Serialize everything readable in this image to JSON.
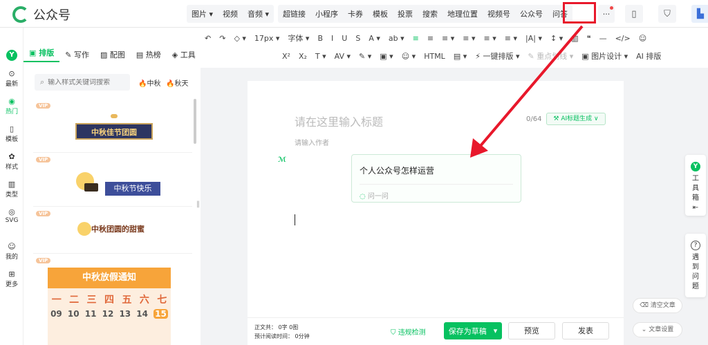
{
  "app": {
    "title": "公众号"
  },
  "topbar": {
    "menu_group_1": [
      "图片 ▾",
      "视频",
      "音频 ▾"
    ],
    "menu_group_2": [
      "超链接",
      "小程序",
      "卡券",
      "模板",
      "投票",
      "搜索",
      "地理位置",
      "视频号",
      "公众号",
      "问答"
    ],
    "more": "···",
    "highlighted": "问答"
  },
  "format_toolbar": {
    "row1": [
      "↶",
      "↷",
      "◇ ▾",
      "17px ▾",
      "字体 ▾",
      "B",
      "I",
      "U",
      "S",
      "A ▾",
      "ab ▾",
      "≡",
      "≡",
      "≡ ▾",
      "≡ ▾",
      "≡ ▾",
      "≡ ▾",
      "|A| ▾",
      "↕ ▾",
      "▥",
      "❝",
      "—",
      "</>",
      "☺"
    ],
    "row2": [
      "X²",
      "X₂",
      "T ▾",
      "AV ▾",
      "✎ ▾",
      "▣ ▾",
      "☺ ▾",
      "HTML",
      "▤ ▾",
      "⚡ 一键排版 ▾",
      "✎ 重点划线 ▾",
      "▣ 图片设计 ▾",
      "AI 排版"
    ]
  },
  "rail": {
    "items": [
      {
        "icon": "⊙",
        "label": "最新"
      },
      {
        "icon": "◉",
        "label": "热门"
      },
      {
        "icon": "▯",
        "label": "模板"
      },
      {
        "icon": "✿",
        "label": "样式"
      },
      {
        "icon": "▥",
        "label": "类型"
      },
      {
        "icon": "◎",
        "label": "SVG"
      },
      {
        "icon": "☺",
        "label": "我的"
      },
      {
        "icon": "⊞",
        "label": "更多"
      }
    ]
  },
  "panel": {
    "tabs": [
      "排版",
      "写作",
      "配图",
      "热榜",
      "工具"
    ],
    "search": {
      "placeholder": "输入样式关键词搜索"
    },
    "tags": [
      "中秋",
      "秋天"
    ],
    "vip_label": "VIP",
    "cards": {
      "c1": "中秋佳节团圆",
      "c2": "中秋节快乐",
      "c3": "中秋团圆的甜蜜",
      "c4": "中秋放假通知"
    },
    "calendar": {
      "weekdays": [
        "一",
        "二",
        "三",
        "四",
        "五",
        "六",
        "七"
      ],
      "days": [
        "09",
        "10",
        "11",
        "12",
        "13",
        "14",
        "15"
      ]
    }
  },
  "editor": {
    "title_placeholder": "请在这里输入标题",
    "title_count": "0/64",
    "ai_title_button": "AI标题生成 ∨",
    "author_placeholder": "请输入作者",
    "qa_card": {
      "title": "个人公众号怎样运营",
      "ask_label": "问一问"
    },
    "footer": {
      "word_count": "正文共： 0字 0图",
      "read_time": "预计阅读时间： 0分钟",
      "violation_check": "违规检测",
      "save_draft": "保存为草稿",
      "preview": "预览",
      "publish": "发表"
    }
  },
  "side": {
    "toolbox": [
      "工",
      "具",
      "箱"
    ],
    "help": [
      "遇",
      "到",
      "问",
      "题"
    ],
    "clear_article": "清空文章",
    "article_settings": "文章设置"
  },
  "colors": {
    "accent": "#07c160",
    "annotation": "#e8182b"
  }
}
